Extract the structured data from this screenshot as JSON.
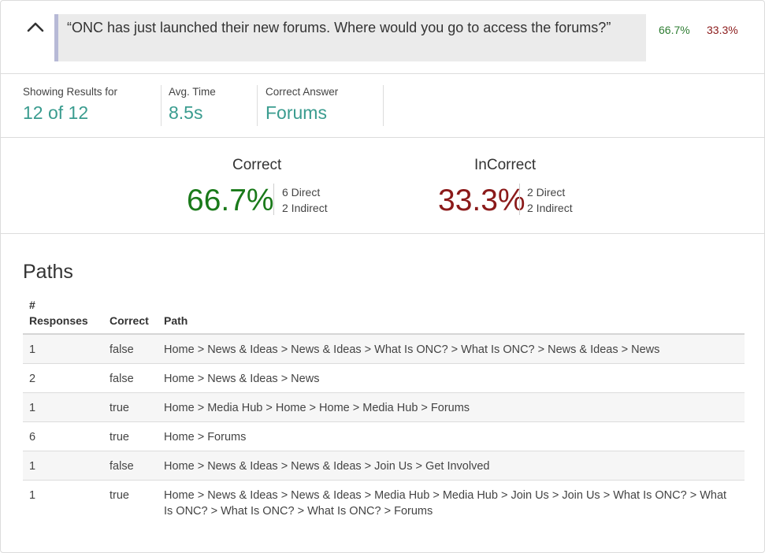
{
  "question": {
    "text": "“ONC has just launched their new forums. Where would you go to access the forums?”",
    "correct_pct": "66.7%",
    "incorrect_pct": "33.3%"
  },
  "stats": {
    "showing_label": "Showing Results for",
    "showing_value": "12 of 12",
    "avg_label": "Avg. Time",
    "avg_value": "8.5s",
    "correct_label": "Correct Answer",
    "correct_value": "Forums"
  },
  "summary": {
    "correct_title": "Correct",
    "correct_pct": "66.7%",
    "correct_direct": "6 Direct",
    "correct_indirect": "2 Indirect",
    "incorrect_title": "InCorrect",
    "incorrect_pct": "33.3%",
    "incorrect_direct": "2 Direct",
    "incorrect_indirect": "2 Indirect"
  },
  "paths": {
    "title": "Paths",
    "headers": {
      "responses_line1": "#",
      "responses_line2": "Responses",
      "correct": "Correct",
      "path": "Path"
    },
    "rows": [
      {
        "responses": "1",
        "correct": "false",
        "path": "Home > News & Ideas > News & Ideas > What Is ONC? > What Is ONC? > News & Ideas > News"
      },
      {
        "responses": "2",
        "correct": "false",
        "path": "Home > News & Ideas > News"
      },
      {
        "responses": "1",
        "correct": "true",
        "path": "Home > Media Hub > Home > Home > Media Hub > Forums"
      },
      {
        "responses": "6",
        "correct": "true",
        "path": "Home > Forums"
      },
      {
        "responses": "1",
        "correct": "false",
        "path": "Home > News & Ideas > News & Ideas > Join Us > Get Involved"
      },
      {
        "responses": "1",
        "correct": "true",
        "path": "Home > News & Ideas > News & Ideas > Media Hub > Media Hub > Join Us > Join Us > What Is ONC? > What Is ONC? > What Is ONC? > What Is ONC? > Forums"
      }
    ]
  },
  "colors": {
    "accent": "#3a9c8f",
    "correct": "#1a7a1a",
    "incorrect": "#8b1a1a"
  },
  "icons": {
    "collapse": "chevron-up-icon"
  }
}
